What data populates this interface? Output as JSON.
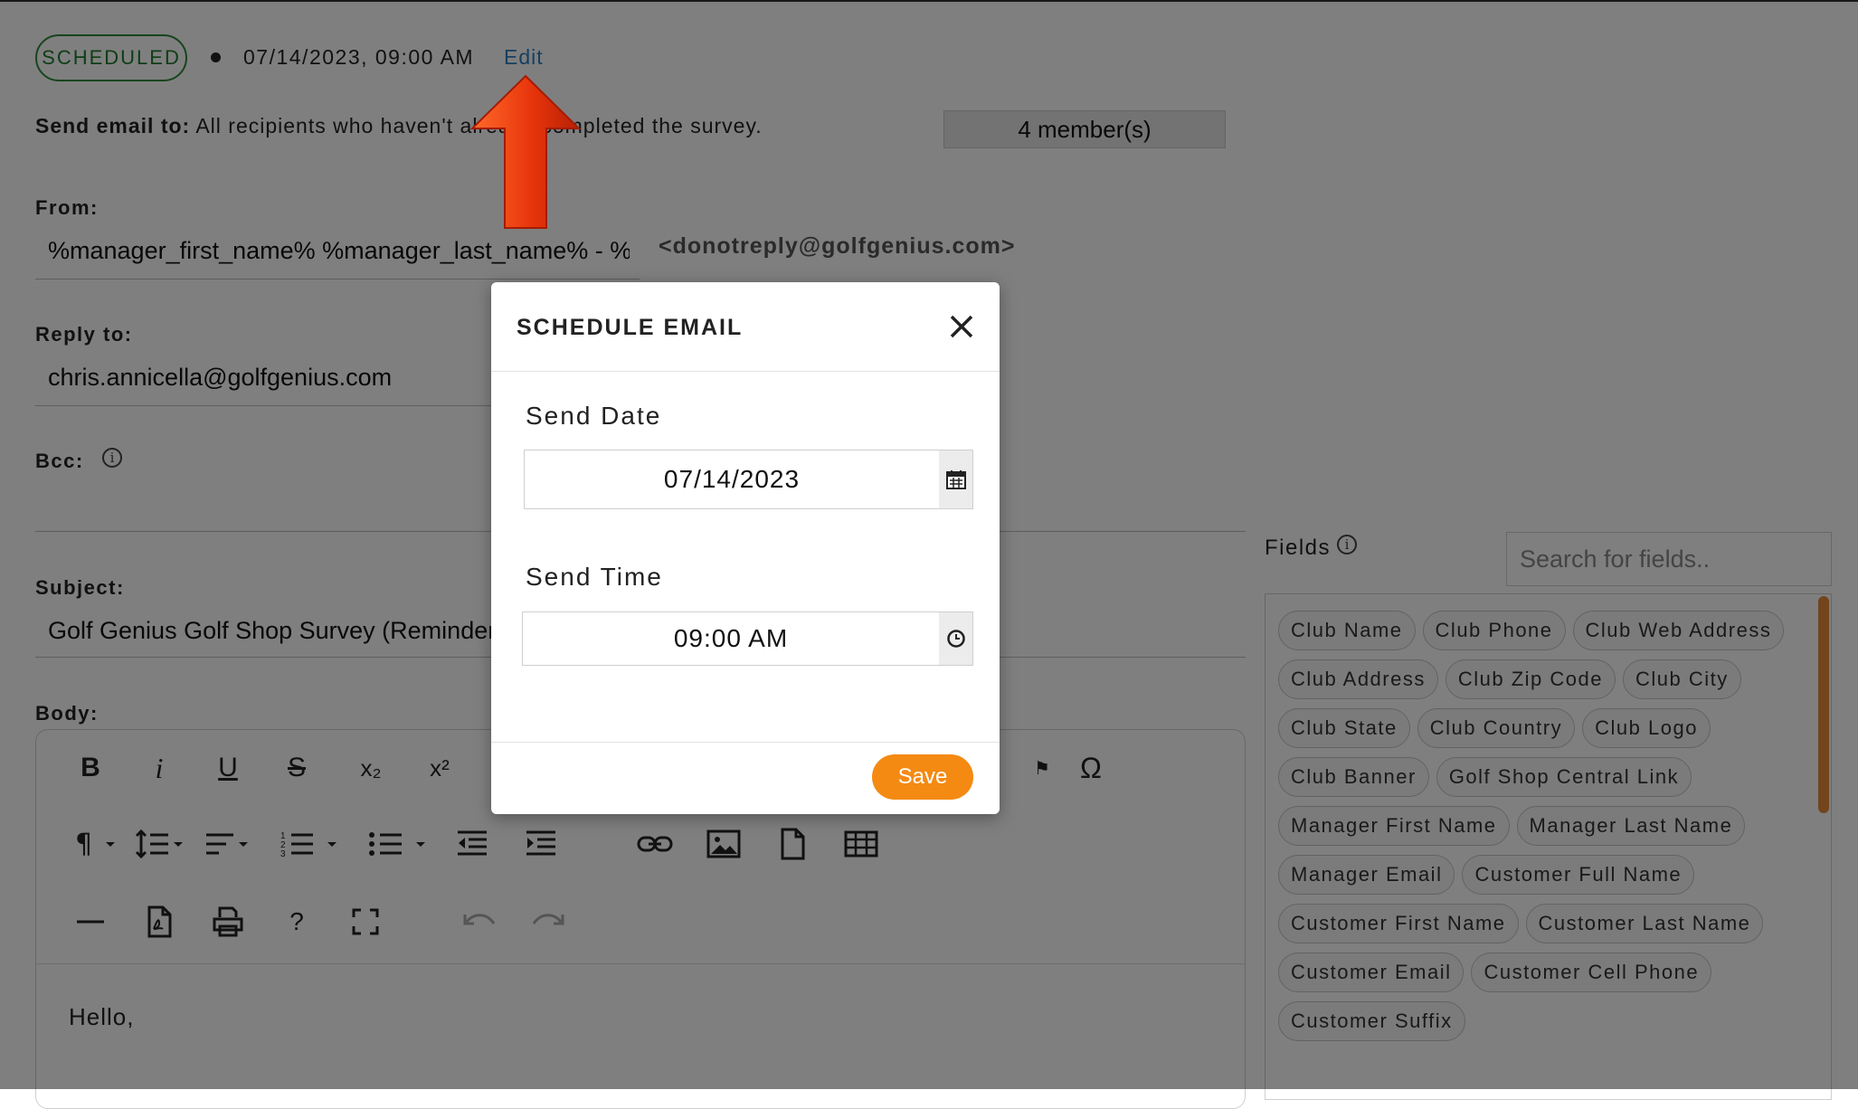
{
  "status": {
    "badge": "SCHEDULED",
    "datetime": "07/14/2023, 09:00 AM",
    "edit_link": "Edit"
  },
  "send_to": {
    "label": "Send email to:",
    "value": "All recipients who haven't already completed the survey.",
    "members": "4 member(s)"
  },
  "from": {
    "label": "From:",
    "value": "%manager_first_name% %manager_last_name% - %",
    "email": "<donotreply@golfgenius.com>"
  },
  "reply_to": {
    "label": "Reply to:",
    "value": "chris.annicella@golfgenius.com"
  },
  "bcc": {
    "label": "Bcc:"
  },
  "subject": {
    "label": "Subject:",
    "value": "Golf Genius Golf Shop Survey (Reminder)"
  },
  "body": {
    "label": "Body:",
    "text": "Hello,",
    "toolbar": {
      "bold": "B",
      "italic": "i",
      "underline": "U",
      "strike": "S",
      "subscript": "x₂",
      "superscript": "x²",
      "special_chars": "Ω",
      "help": "?"
    }
  },
  "fields": {
    "label": "Fields",
    "search_placeholder": "Search for fields..",
    "chips": [
      "Club Name",
      "Club Phone",
      "Club Web Address",
      "Club Address",
      "Club Zip Code",
      "Club City",
      "Club State",
      "Club Country",
      "Club Logo",
      "Club Banner",
      "Golf Shop Central Link",
      "Manager First Name",
      "Manager Last Name",
      "Manager Email",
      "Customer Full Name",
      "Customer First Name",
      "Customer Last Name",
      "Customer Email",
      "Customer Cell Phone",
      "Customer Suffix"
    ]
  },
  "modal": {
    "title": "SCHEDULE EMAIL",
    "send_date_label": "Send Date",
    "send_date_value": "07/14/2023",
    "send_time_label": "Send Time",
    "send_time_value": "09:00 AM",
    "save_label": "Save"
  },
  "colors": {
    "accent_orange": "#f48a12",
    "link_blue": "#2f7fc0",
    "status_green": "#2e8b3a",
    "arrow_red": "#e8350c"
  }
}
